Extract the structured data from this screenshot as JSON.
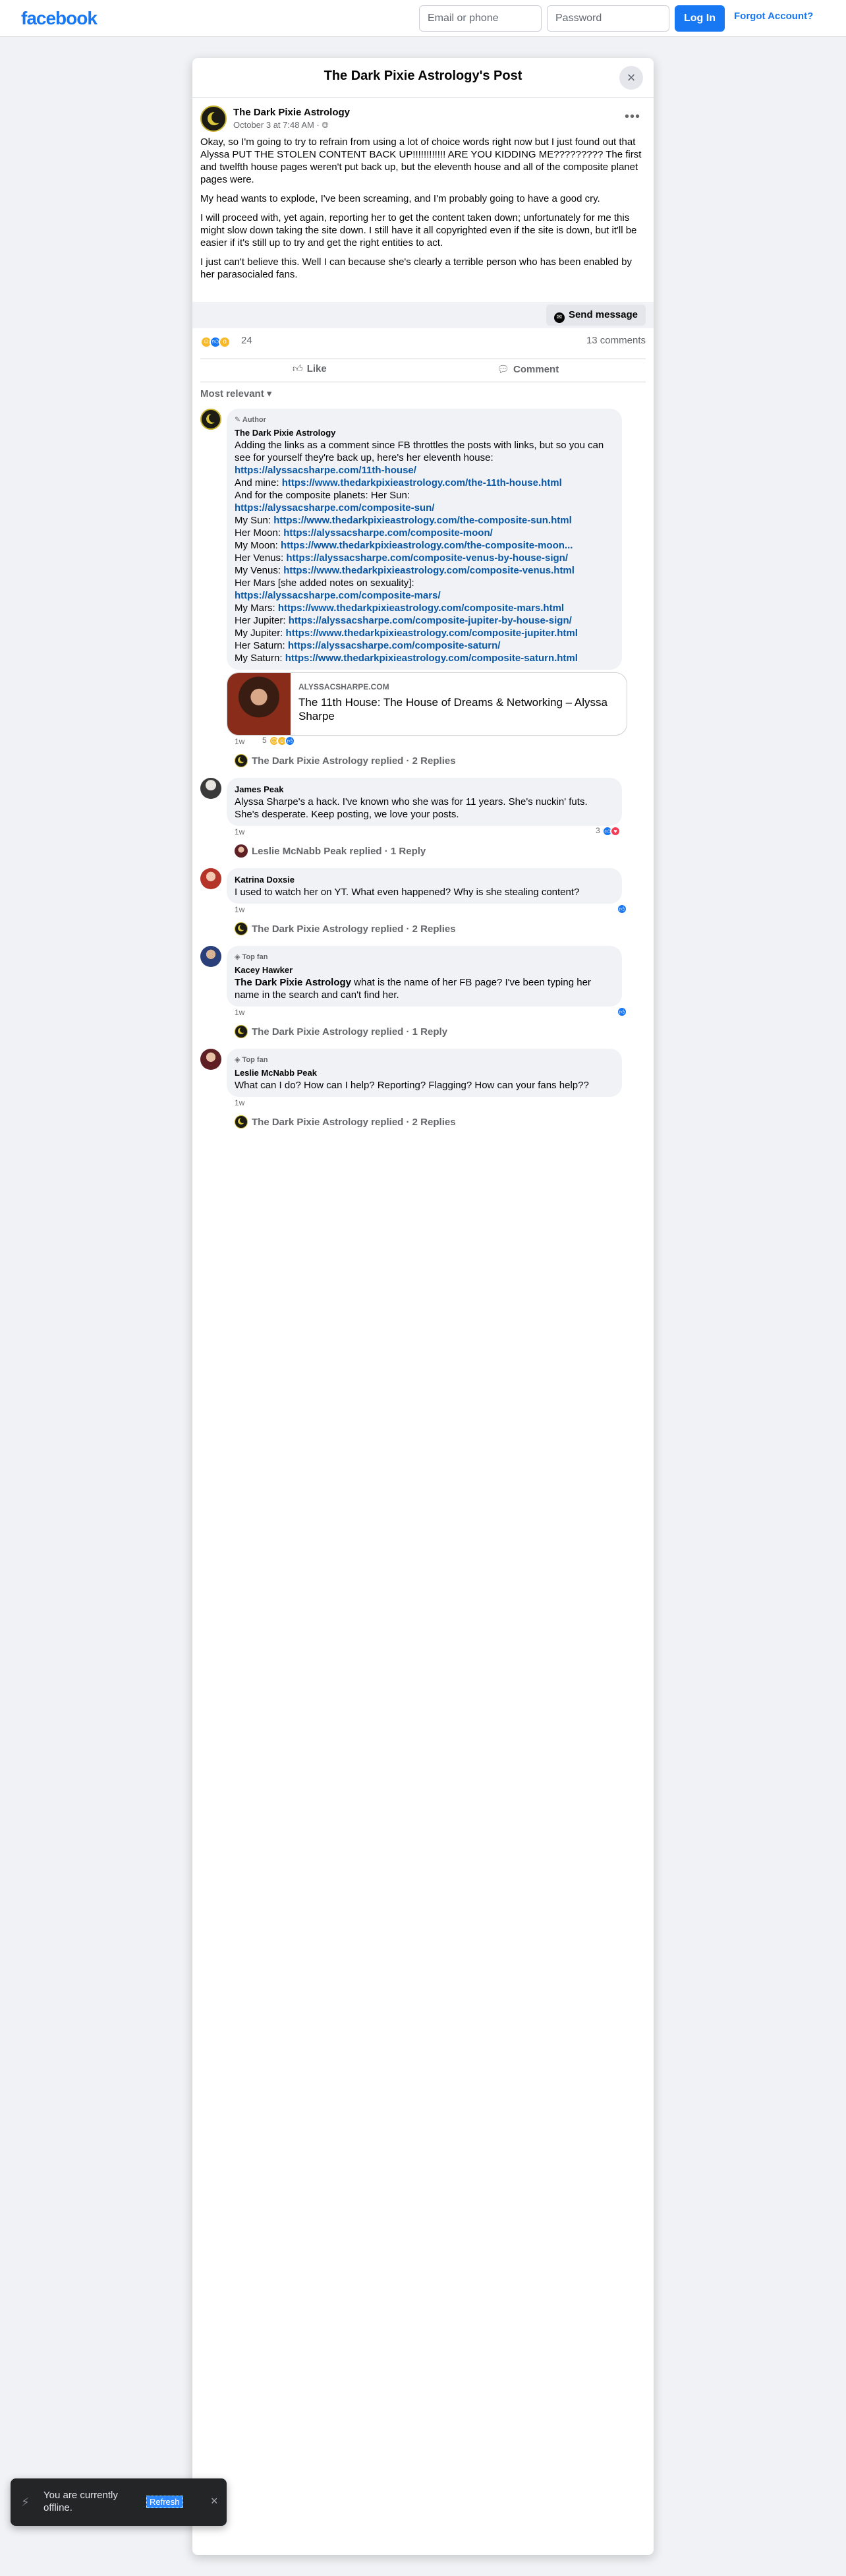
{
  "topbar": {
    "logo": "facebook",
    "email_placeholder": "Email or phone",
    "password_placeholder": "Password",
    "login_label": "Log In",
    "forgot_label": "Forgot Account?"
  },
  "modal": {
    "title": "The Dark Pixie Astrology's Post",
    "close_icon": "close-icon"
  },
  "post": {
    "author": "The Dark Pixie Astrology",
    "time": "October 3 at 7:48 AM · ",
    "privacy_icon": "globe-icon",
    "paragraphs": [
      "Okay, so I'm going to try to refrain from using a lot of choice words right now but I just found out that Alyssa PUT THE STOLEN CONTENT BACK UP!!!!!!!!!!!! ARE YOU KIDDING ME????????? The first and twelfth house pages weren't put back up, but the eleventh house and all of the composite planet pages were.",
      "My head wants to explode, I've been screaming, and I'm probably going to have a good cry.",
      "I will proceed with, yet again, reporting her to get the content taken down; unfortunately for me this might slow down taking the site down. I still have it all copyrighted even if the site is down, but it'll be easier if it's still up to try and get the right entities to act.",
      "I just can't believe this. Well I can because she's clearly a terrible person who has been enabled by her parasocialed fans."
    ],
    "send_message": "Send message",
    "reaction_count": "24",
    "comment_count": "13 comments",
    "like_label": "Like",
    "comment_label": "Comment",
    "sort_label": "Most relevant"
  },
  "author_comment": {
    "badge": "Author",
    "name": "The Dark Pixie Astrology",
    "intro": "Adding the links as a comment since FB throttles the posts with links, but so you can see for yourself they're back up, here's her eleventh house:",
    "link1": "https://alyssacsharpe.com/11th-house/",
    "mine_label": "And mine: ",
    "link2": "https://www.thedarkpixieastrology.com/the-11th-house.html",
    "composite_intro": "And for the composite planets: Her Sun:",
    "her_sun": "https://alyssacsharpe.com/composite-sun/",
    "my_sun_label": "My Sun: ",
    "my_sun": "https://www.thedarkpixieastrology.com/the-composite-sun.html",
    "her_moon_label": "Her Moon: ",
    "her_moon": "https://alyssacsharpe.com/composite-moon/",
    "my_moon_label": "My Moon: ",
    "my_moon": "https://www.thedarkpixieastrology.com/the-composite-moon...",
    "her_venus_label": "Her Venus: ",
    "her_venus": "https://alyssacsharpe.com/composite-venus-by-house-sign/",
    "my_venus_label": "My Venus: ",
    "my_venus": "https://www.thedarkpixieastrology.com/composite-venus.html",
    "her_mars_label": "Her Mars [she added notes on sexuality]:",
    "her_mars": "https://alyssacsharpe.com/composite-mars/",
    "my_mars_label": "My Mars: ",
    "my_mars": "https://www.thedarkpixieastrology.com/composite-mars.html",
    "her_jupiter_label": "Her Jupiter: ",
    "her_jupiter": "https://alyssacsharpe.com/composite-jupiter-by-house-sign/",
    "my_jupiter_label": "My Jupiter: ",
    "my_jupiter": "https://www.thedarkpixieastrology.com/composite-jupiter.html",
    "her_saturn_label": "Her Saturn: ",
    "her_saturn": "https://alyssacsharpe.com/composite-saturn/",
    "my_saturn_label": "My Saturn: ",
    "my_saturn": "https://www.thedarkpixieastrology.com/composite-saturn.html",
    "card_domain": "ALYSSACSHARPE.COM",
    "card_title": "The 11th House: The House of Dreams & Networking – Alyssa Sharpe",
    "age": "1w",
    "reaction_count": "5",
    "replied": "The Dark Pixie Astrology replied · 2 Replies"
  },
  "comments": [
    {
      "name": "James Peak",
      "text": "Alyssa Sharpe's a hack. I've known who she was for 11 years. She's nuckin' futs. She's desperate. Keep posting, we love your posts.",
      "age": "1w",
      "reaction_count": "3",
      "replied": "Leslie McNabb Peak replied · 1 Reply"
    },
    {
      "name": "Katrina Doxsie",
      "text": "I used to watch her on YT. What even happened? Why is she stealing content?",
      "age": "1w",
      "replied": "The Dark Pixie Astrology replied · 2 Replies"
    },
    {
      "badge": "Top fan",
      "name": "Kacey Hawker",
      "mention": "The Dark Pixie Astrology",
      "text": " what is the name of her FB page? I've been typing her name in the search and can't find her.",
      "age": "1w",
      "replied": "The Dark Pixie Astrology replied · 1 Reply"
    },
    {
      "badge": "Top fan",
      "name": "Leslie McNabb Peak",
      "text": "What can I do? How can I help? Reporting? Flagging? How can your fans help??",
      "age": "1w",
      "replied": "The Dark Pixie Astrology replied · 2 Replies"
    }
  ],
  "toast": {
    "text": "You are currently offline.",
    "refresh": "Refresh"
  },
  "colors": {
    "brand": "#1877f2",
    "link": "#0a58a6",
    "bubble": "#f0f2f5"
  }
}
